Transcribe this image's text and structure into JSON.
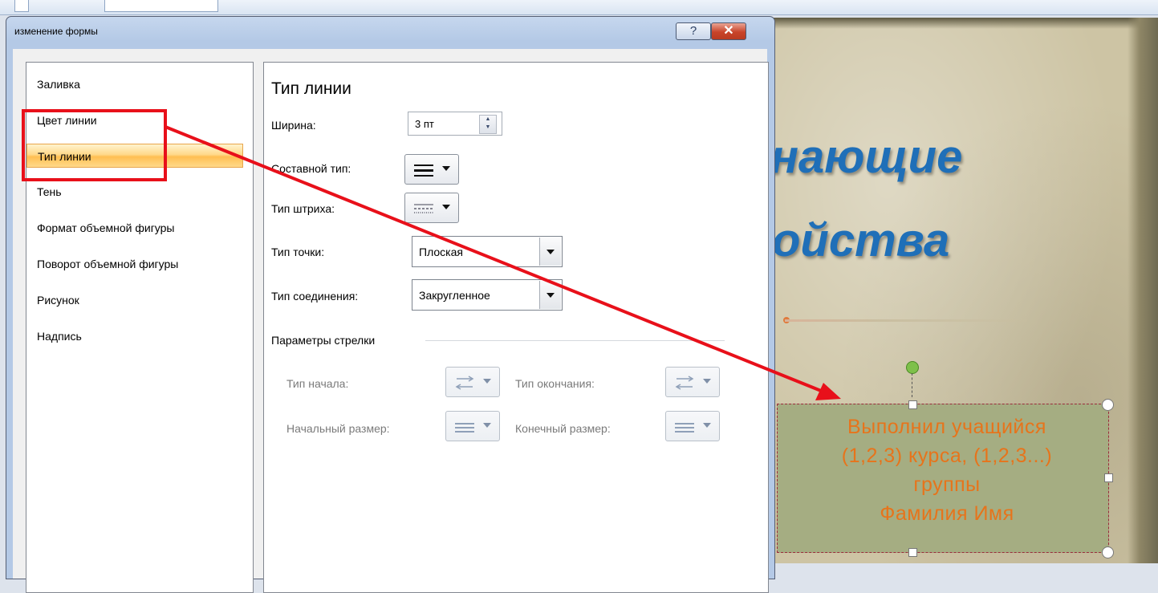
{
  "dialog": {
    "title": "изменение формы",
    "help_label": "?",
    "close_label": "✕"
  },
  "nav": {
    "items": [
      {
        "label": "Заливка"
      },
      {
        "label": "Цвет линии"
      },
      {
        "label": "Тип линии",
        "selected": true
      },
      {
        "label": "Тень"
      },
      {
        "label": "Формат объемной фигуры"
      },
      {
        "label": "Поворот объемной фигуры"
      },
      {
        "label": "Рисунок"
      },
      {
        "label": "Надпись"
      }
    ]
  },
  "line_type": {
    "section_title": "Тип линии",
    "width": {
      "label": "Ширина:",
      "value": "3 пт"
    },
    "compound_type": {
      "label": "Составной тип:"
    },
    "dash_type": {
      "label": "Тип штриха:"
    },
    "cap_type": {
      "label": "Тип точки:",
      "value": "Плоская"
    },
    "join_type": {
      "label": "Тип соединения:",
      "value": "Закругленное"
    },
    "arrow_group": {
      "label": "Параметры стрелки",
      "begin_type_label": "Тип начала:",
      "end_type_label": "Тип окончания:",
      "begin_size_label": "Начальный размер:",
      "end_size_label": "Конечный размер:"
    }
  },
  "slide": {
    "title_line1": "нающие",
    "title_line2": "ойства",
    "title_color": "#1f6fb8",
    "textbox_lines": [
      "Выполнил учащийся",
      "(1,2,3) курса, (1,2,3...)",
      "группы",
      "Фамилия Имя"
    ],
    "textbox_color": "#e7741b"
  },
  "annotation": {
    "color": "#e8101a"
  }
}
